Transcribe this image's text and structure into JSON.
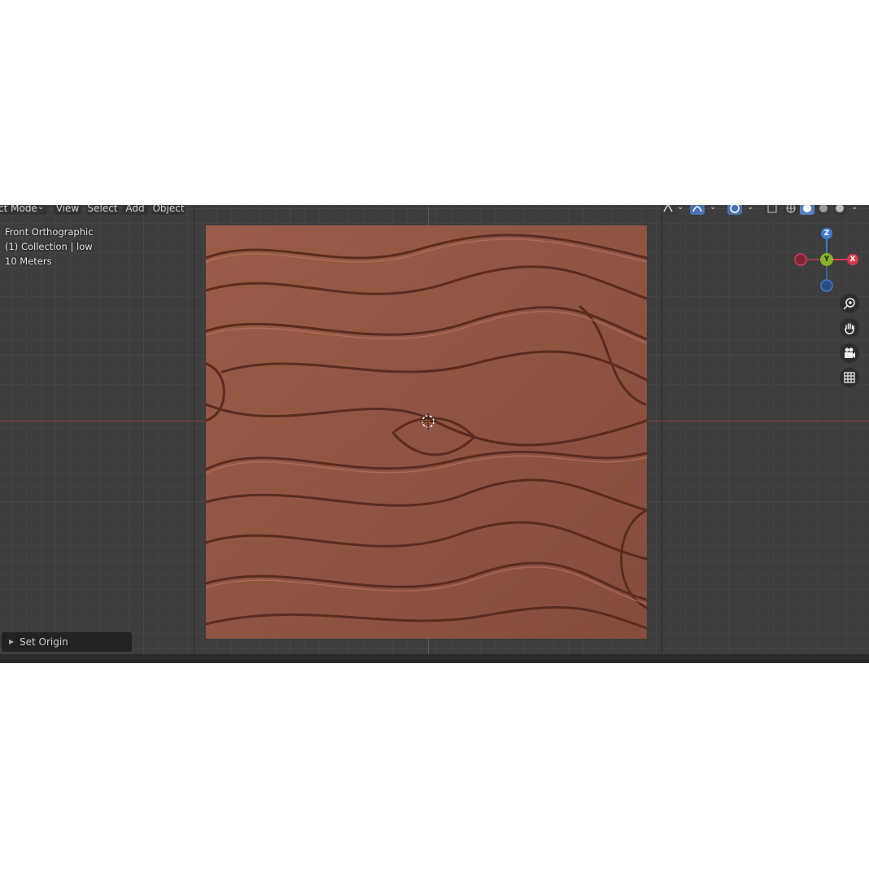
{
  "header": {
    "mode_label": "ct Mode",
    "menus": [
      "View",
      "Select",
      "Add",
      "Object"
    ]
  },
  "viewport": {
    "view_name": "Front Orthographic",
    "collection": "(1) Collection | low",
    "scale": "10 Meters"
  },
  "gizmo": {
    "axis_z": "Z",
    "axis_y": "Y",
    "axis_x": "X",
    "colors": {
      "x": "#d93a4e",
      "y": "#86b02a",
      "z": "#3f7ccc"
    }
  },
  "side_tools": [
    "zoom-icon",
    "hand-pan-icon",
    "camera-icon",
    "grid-icon"
  ],
  "last_operation": {
    "label": "Set Origin"
  },
  "colors": {
    "texture": "#8f5442",
    "viewport_bg": "#3d3d3d"
  }
}
